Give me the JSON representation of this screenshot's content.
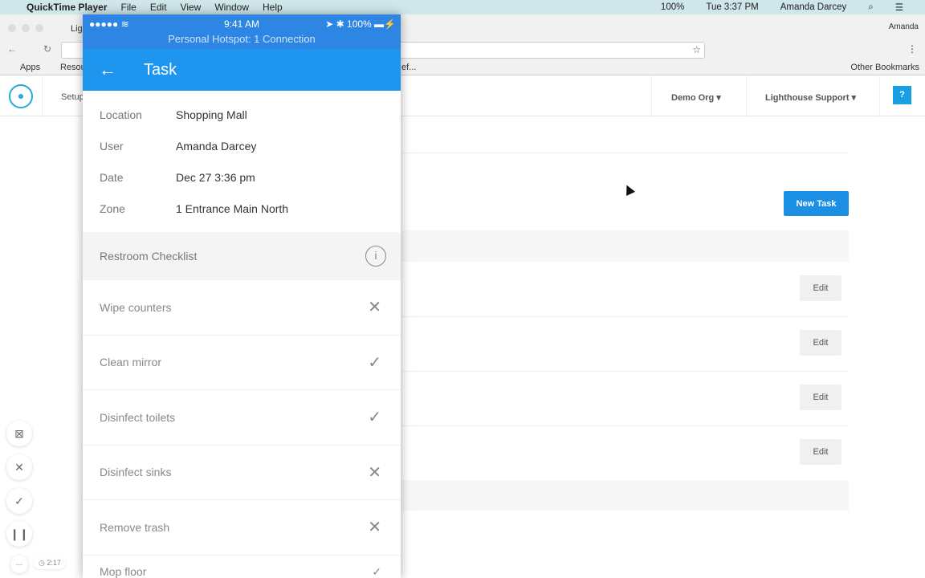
{
  "menubar": {
    "app": "QuickTime Player",
    "items": [
      "File",
      "Edit",
      "View",
      "Window",
      "Help"
    ],
    "battery": "100%",
    "clock": "Tue 3:37 PM",
    "user": "Amanda Darcey"
  },
  "browser": {
    "tab": "Lig",
    "profile": "Amanda",
    "bookmarks": {
      "apps": "Apps",
      "resources": "Resou",
      "other": "Other Bookmarks",
      "trunc": "ef..."
    }
  },
  "app": {
    "setup": "Setup",
    "org": "Demo Org",
    "support": "Lighthouse Support",
    "help": "?",
    "new_task": "New Task",
    "edit": "Edit"
  },
  "phone": {
    "carrier": "●●●●● ",
    "time": "9:41 AM",
    "battery": "100%",
    "hotspot": "Personal Hotspot: 1 Connection",
    "title": "Task",
    "info": [
      {
        "k": "Location",
        "v": "Shopping Mall"
      },
      {
        "k": "User",
        "v": "Amanda Darcey"
      },
      {
        "k": "Date",
        "v": "Dec 27 3:36 pm"
      },
      {
        "k": "Zone",
        "v": "1 Entrance Main North"
      }
    ],
    "checklist": "Restroom Checklist",
    "items": [
      {
        "label": "Wipe counters",
        "status": "fail"
      },
      {
        "label": "Clean mirror",
        "status": "pass"
      },
      {
        "label": "Disinfect toilets",
        "status": "pass"
      },
      {
        "label": "Disinfect sinks",
        "status": "fail"
      },
      {
        "label": "Remove trash",
        "status": "fail"
      },
      {
        "label": "Mop floor",
        "status": "pass"
      }
    ]
  },
  "recorder": {
    "timer": "2:17"
  }
}
